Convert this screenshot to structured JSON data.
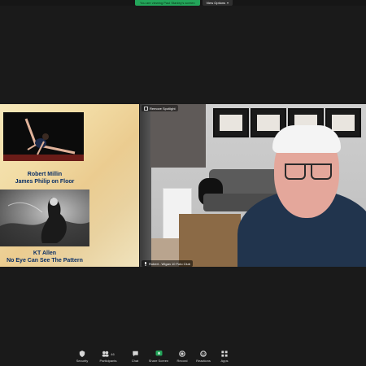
{
  "banner": {
    "share_text": "You are viewing Paul Stanley's screen",
    "view_options_label": "View Options"
  },
  "slide": {
    "caption1_line1": "Robert Millin",
    "caption1_line2": "James Philip on Floor",
    "caption2_line1": "KT Allen",
    "caption2_line2": "No Eye Can See The Pattern"
  },
  "video": {
    "remove_spotlight_label": "Remove Spotlight",
    "participant_name": "Robert - Wigan 10 Foto Club"
  },
  "toolbar": {
    "items": [
      {
        "label": "Security",
        "icon": "shield-icon"
      },
      {
        "label": "Participants",
        "icon": "participants-icon",
        "count": "46"
      },
      {
        "label": "Chat",
        "icon": "chat-icon"
      },
      {
        "label": "Share Screen",
        "icon": "share-screen-icon"
      },
      {
        "label": "Record",
        "icon": "record-icon"
      },
      {
        "label": "Reactions",
        "icon": "reactions-icon"
      },
      {
        "label": "Apps",
        "icon": "apps-icon"
      }
    ]
  },
  "colors": {
    "share_banner": "#23a55a",
    "slide_caption": "#0a2f66",
    "toolbar_bg": "#1a1a1a"
  }
}
